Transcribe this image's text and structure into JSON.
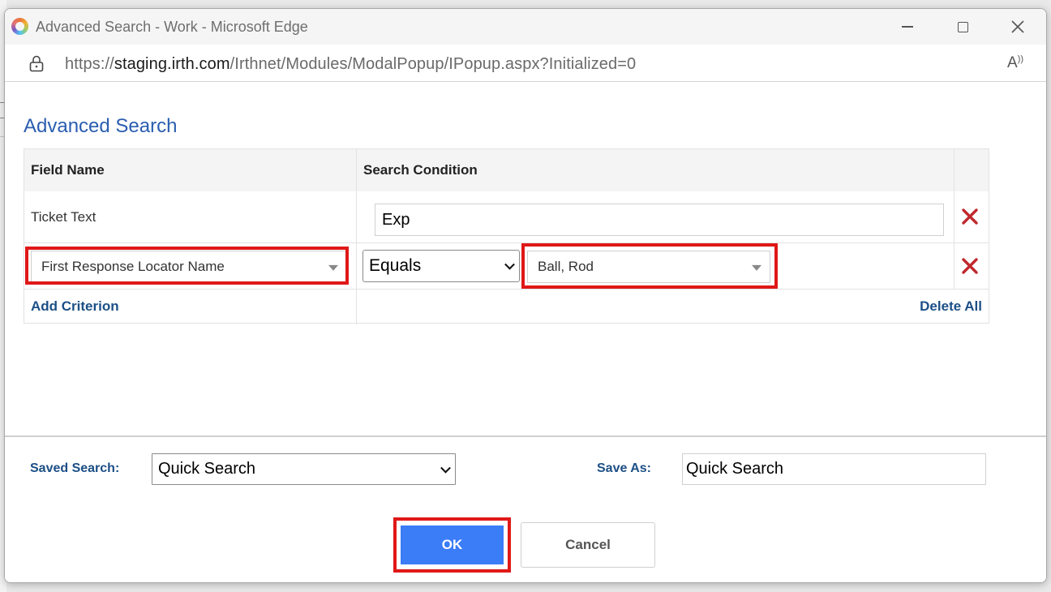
{
  "window": {
    "title": "Advanced Search - Work - Microsoft Edge",
    "url_prefix": "https://",
    "url_host": "staging.irth.com",
    "url_path": "/Irthnet/Modules/ModalPopup/IPopup.aspx?Initialized=0"
  },
  "dialog": {
    "title": "Advanced Search",
    "columns": {
      "field_name": "Field Name",
      "search_condition": "Search Condition"
    },
    "rows": [
      {
        "field_label": "Ticket Text",
        "value": "Exp"
      },
      {
        "field_select": "First Response Locator Name",
        "operator": "Equals",
        "value_select": "Ball, Rod"
      }
    ],
    "add_criterion": "Add Criterion",
    "delete_all": "Delete All"
  },
  "footer": {
    "saved_search_label": "Saved Search:",
    "saved_search_value": "Quick Search",
    "save_as_label": "Save As:",
    "save_as_value": "Quick Search",
    "ok_label": "OK",
    "cancel_label": "Cancel"
  },
  "colors": {
    "accent": "#2a5db0",
    "link": "#1c4f86",
    "ok_button": "#3b7cf7",
    "highlight": "#e01818",
    "delete_icon": "#c0282d"
  },
  "icons": [
    "app-icon",
    "minimize-icon",
    "maximize-icon",
    "close-icon",
    "lock-icon",
    "read-aloud-icon",
    "delete-icon",
    "dropdown-icon"
  ]
}
